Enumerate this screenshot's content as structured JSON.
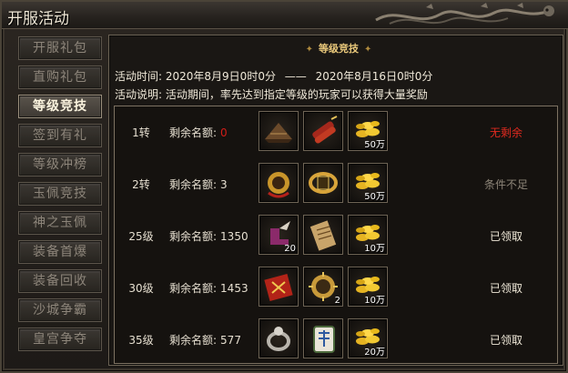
{
  "window": {
    "title": "开服活动"
  },
  "sidebar": {
    "items": [
      {
        "label": "开服礼包",
        "active": false
      },
      {
        "label": "直购礼包",
        "active": false
      },
      {
        "label": "等级竞技",
        "active": true
      },
      {
        "label": "签到有礼",
        "active": false
      },
      {
        "label": "等级冲榜",
        "active": false
      },
      {
        "label": "玉佩竞技",
        "active": false
      },
      {
        "label": "神之玉佩",
        "active": false
      },
      {
        "label": "装备首爆",
        "active": false
      },
      {
        "label": "装备回收",
        "active": false
      },
      {
        "label": "沙城争霸",
        "active": false
      },
      {
        "label": "皇宫争夺",
        "active": false
      }
    ]
  },
  "panel": {
    "banner": "等级竞技",
    "time_label": "活动时间:",
    "time_start": "2020年8月9日0时0分",
    "time_sep": "——",
    "time_end": "2020年8月16日0时0分",
    "desc_label": "活动说明:",
    "desc_text": "活动期间，率先达到指定等级的玩家可以获得大量奖励"
  },
  "rows": [
    {
      "stage": "1转",
      "quota_label": "剩余名额:",
      "quota": "0",
      "quota_color": "#d21d18",
      "rewards": [
        {
          "icon": "straw-hat-icon",
          "count": ""
        },
        {
          "icon": "firecracker-bundle-icon",
          "count": ""
        },
        {
          "icon": "gold-coins-icon",
          "count": "50万"
        }
      ],
      "status": "无剩余",
      "status_color": "#e02a1f"
    },
    {
      "stage": "2转",
      "quota_label": "剩余名额:",
      "quota": "3",
      "quota_color": "#e6dfd0",
      "rewards": [
        {
          "icon": "gold-orb-icon",
          "count": ""
        },
        {
          "icon": "gold-bracelet-icon",
          "count": ""
        },
        {
          "icon": "gold-coins-icon",
          "count": "50万"
        }
      ],
      "status": "条件不足",
      "status_color": "#8d8578"
    },
    {
      "stage": "25级",
      "quota_label": "剩余名额:",
      "quota": "1350",
      "quota_color": "#e6dfd0",
      "rewards": [
        {
          "icon": "winged-boot-icon",
          "count": "20"
        },
        {
          "icon": "scroll-icon",
          "count": ""
        },
        {
          "icon": "gold-coins-icon",
          "count": "10万"
        }
      ],
      "status": "已领取",
      "status_color": "#efe8d8"
    },
    {
      "stage": "30级",
      "quota_label": "剩余名额:",
      "quota": "1453",
      "quota_color": "#e6dfd0",
      "rewards": [
        {
          "icon": "talisman-card-icon",
          "count": ""
        },
        {
          "icon": "sun-medal-icon",
          "count": "2"
        },
        {
          "icon": "gold-coins-icon",
          "count": "10万"
        }
      ],
      "status": "已领取",
      "status_color": "#efe8d8"
    },
    {
      "stage": "35级",
      "quota_label": "剩余名额:",
      "quota": "577",
      "quota_color": "#e6dfd0",
      "rewards": [
        {
          "icon": "silver-ring-icon",
          "count": ""
        },
        {
          "icon": "mahjong-tile-icon",
          "count": ""
        },
        {
          "icon": "gold-coins-icon",
          "count": "20万"
        }
      ],
      "status": "已领取",
      "status_color": "#efe8d8"
    }
  ]
}
